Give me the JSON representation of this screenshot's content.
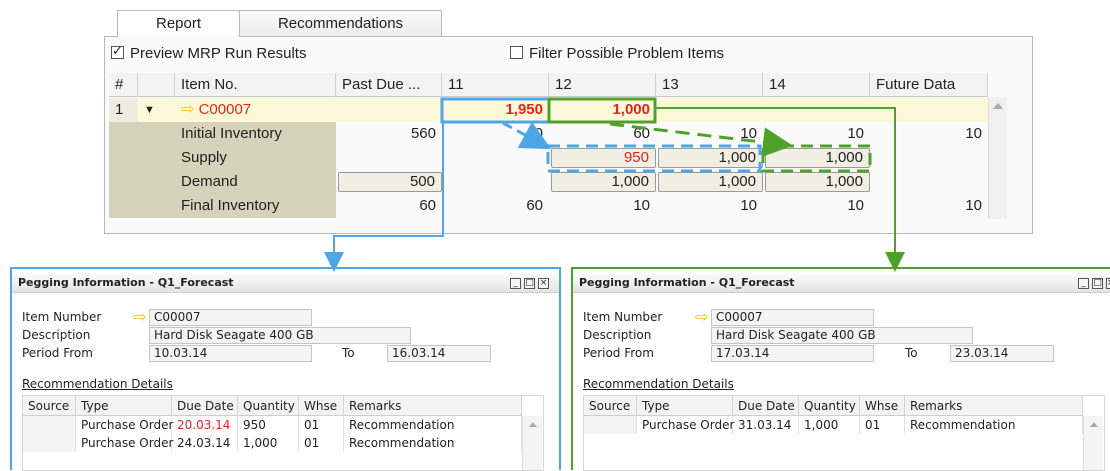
{
  "tabs": [
    {
      "label": "Report",
      "active": true
    },
    {
      "label": "Recommendations",
      "active": false
    }
  ],
  "options": {
    "preview": {
      "label": "Preview MRP Run Results",
      "checked": true
    },
    "filter": {
      "label": "Filter Possible Problem Items",
      "checked": false
    }
  },
  "table": {
    "headers": [
      "#",
      "",
      "Item No.",
      "Past Due ...",
      "11",
      "12",
      "13",
      "14",
      "Future Data"
    ],
    "item_row": {
      "num": "1",
      "toggle": "▼",
      "item": "C00007",
      "p11": "1,950",
      "p12": "1,000"
    },
    "rows": [
      {
        "label": "Initial Inventory",
        "past": "560",
        "p11": "60",
        "p12": "60",
        "p13": "10",
        "p14": "10",
        "future": "10"
      },
      {
        "label": "Supply",
        "past": "",
        "p11": "",
        "p12": "950",
        "p13": "1,000",
        "p14": "1,000",
        "future": ""
      },
      {
        "label": "Demand",
        "past": "500",
        "p11": "",
        "p12": "1,000",
        "p13": "1,000",
        "p14": "1,000",
        "future": ""
      },
      {
        "label": "Final Inventory",
        "past": "60",
        "p11": "60",
        "p12": "10",
        "p13": "10",
        "p14": "10",
        "future": "10"
      }
    ]
  },
  "pegging": [
    {
      "title": "Pegging Information - Q1_Forecast",
      "labels": {
        "item_number": "Item Number",
        "description": "Description",
        "period_from": "Period From",
        "to": "To",
        "details": "Recommendation Details"
      },
      "item_number": "C00007",
      "description": "Hard Disk Seagate 400 GB",
      "period_from": "10.03.14",
      "period_to": "16.03.14",
      "columns": [
        "Source",
        "Type",
        "Due Date",
        "Quantity",
        "Whse",
        "Remarks"
      ],
      "rows": [
        {
          "source": "",
          "type": "Purchase Order",
          "due": "20.03.14",
          "qty": "950",
          "whse": "01",
          "remarks": "Recommendation",
          "due_red": true
        },
        {
          "source": "",
          "type": "Purchase Order",
          "due": "24.03.14",
          "qty": "1,000",
          "whse": "01",
          "remarks": "Recommendation",
          "due_red": false
        }
      ]
    },
    {
      "title": "Pegging Information - Q1_Forecast",
      "labels": {
        "item_number": "Item Number",
        "description": "Description",
        "period_from": "Period From",
        "to": "To",
        "details": "Recommendation Details"
      },
      "item_number": "C00007",
      "description": "Hard Disk Seagate 400 GB",
      "period_from": "17.03.14",
      "period_to": "23.03.14",
      "columns": [
        "Source",
        "Type",
        "Due Date",
        "Quantity",
        "Whse",
        "Remarks"
      ],
      "rows": [
        {
          "source": "",
          "type": "Purchase Order",
          "due": "31.03.14",
          "qty": "1,000",
          "whse": "01",
          "remarks": "Recommendation",
          "due_red": false
        }
      ]
    }
  ],
  "colors": {
    "blue": "#4ea6e6",
    "green": "#4ea22a",
    "red": "#e0261c",
    "arrow": "#f3c300",
    "highlight_row": "#fdf9d8",
    "shaded": "#d6d3ba"
  }
}
